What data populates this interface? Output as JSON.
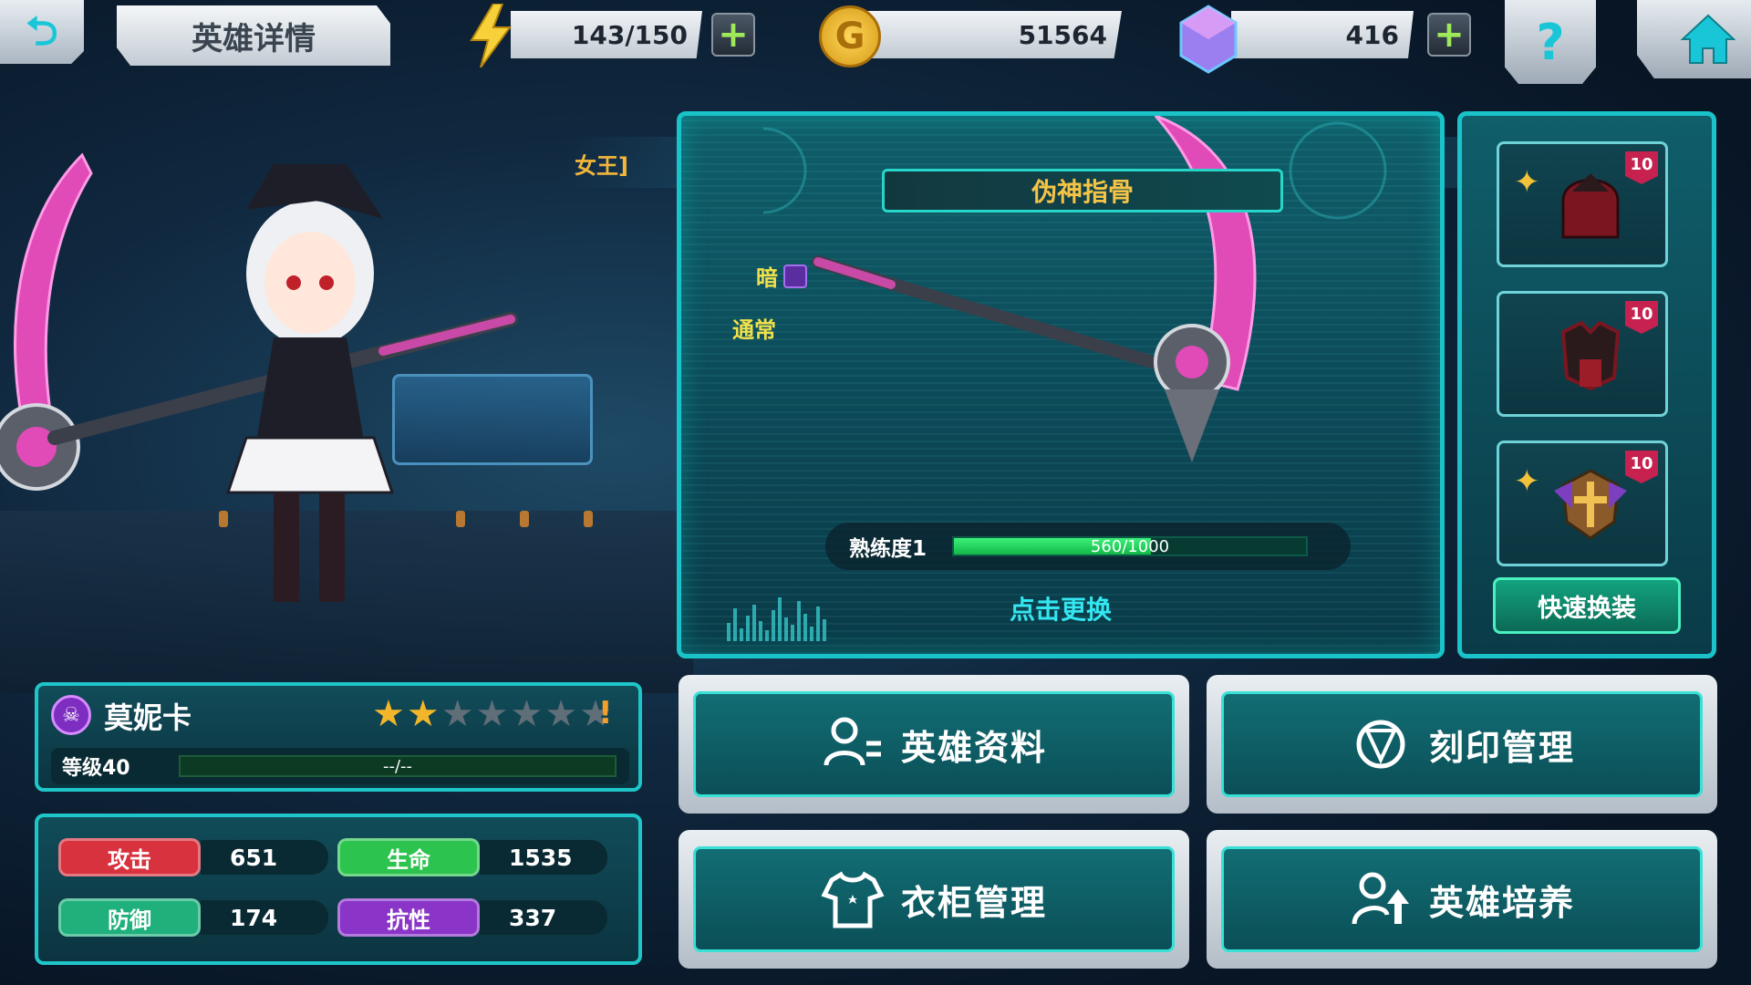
{
  "topbar": {
    "title": "英雄详情",
    "energy": "143/150",
    "gold": "51564",
    "gems": "416",
    "help_glyph": "?"
  },
  "icons": {
    "energy": "lightning-icon",
    "gold": "gold-coin-icon",
    "gems": "crystal-icon",
    "home": "home-icon",
    "back": "back-arrow-icon"
  },
  "hero": {
    "title_fragment": "女王]",
    "name": "莫妮卡",
    "stars_filled": 2,
    "stars_total": 7,
    "level_label": "等级40",
    "exp_text": "--/--",
    "stats": {
      "attack_label": "攻击",
      "attack": "651",
      "hp_label": "生命",
      "hp": "1535",
      "defense_label": "防御",
      "defense": "174",
      "resist_label": "抗性",
      "resist": "337"
    }
  },
  "weapon": {
    "name": "伪神指骨",
    "element": "暗",
    "type": "通常",
    "proficiency_label": "熟练度1",
    "proficiency_current": 560,
    "proficiency_max": 1000,
    "proficiency_text": "560/1000",
    "tap_to_change": "点击更换"
  },
  "equipment": {
    "slots": [
      {
        "level": "10",
        "starred": true,
        "item": "helmet-icon"
      },
      {
        "level": "10",
        "starred": false,
        "item": "armor-icon"
      },
      {
        "level": "10",
        "starred": true,
        "item": "emblem-icon"
      }
    ],
    "quick_equip": "快速换装"
  },
  "menu": {
    "hero_info": "英雄资料",
    "imprint": "刻印管理",
    "wardrobe": "衣柜管理",
    "training": "英雄培养"
  },
  "colors": {
    "accent": "#19c3c9",
    "attack": "#d8323f",
    "hp": "#2cc34f",
    "defense": "#1fb07c",
    "resist": "#8a35c8",
    "proficiency": "#3cf07a"
  }
}
